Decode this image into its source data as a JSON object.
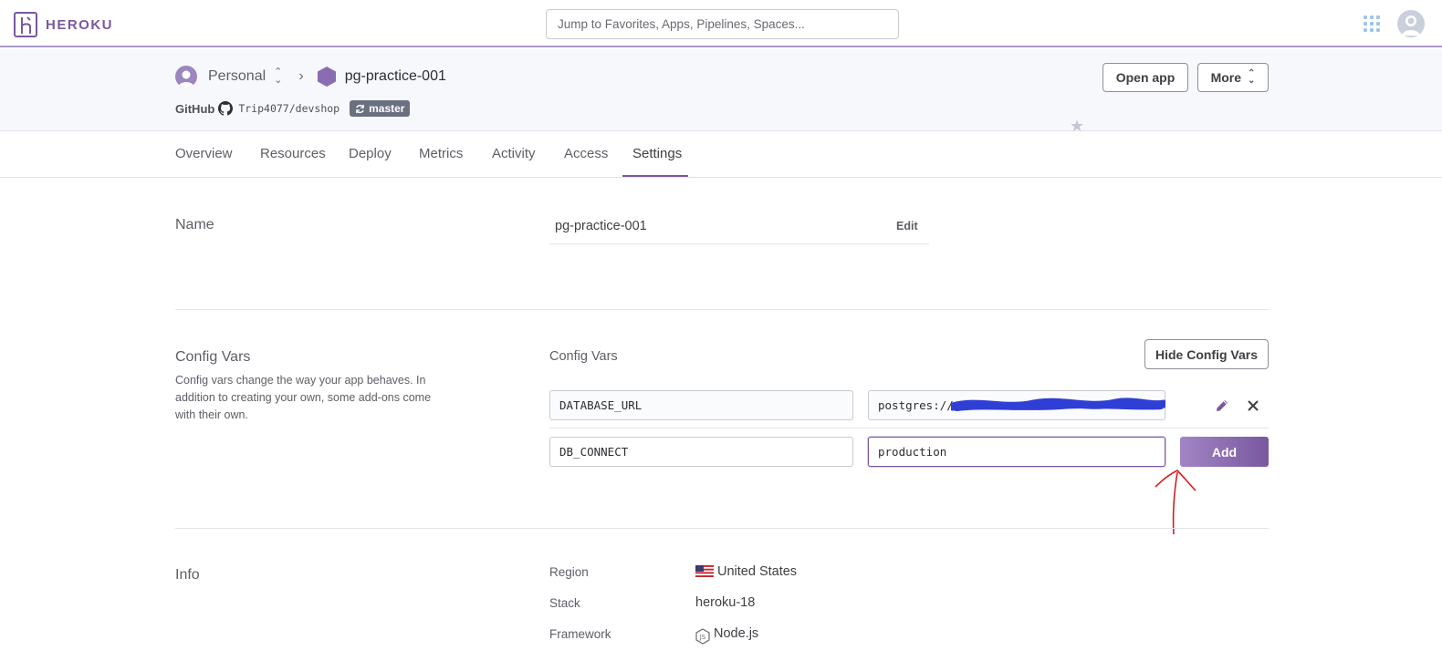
{
  "topbar": {
    "brand": "HEROKU",
    "search_placeholder": "Jump to Favorites, Apps, Pipelines, Spaces..."
  },
  "header": {
    "account": "Personal",
    "app_name": "pg-practice-001",
    "git_provider": "GitHub",
    "repo": "Trip4077/devshop",
    "branch": "master",
    "open_app": "Open app",
    "more": "More"
  },
  "tabs": [
    "Overview",
    "Resources",
    "Deploy",
    "Metrics",
    "Activity",
    "Access",
    "Settings"
  ],
  "active_tab": "Settings",
  "name_section": {
    "title": "Name",
    "value": "pg-practice-001",
    "edit": "Edit"
  },
  "config_vars": {
    "title": "Config Vars",
    "description": "Config vars change the way your app behaves. In addition to creating your own, some add-ons come with their own.",
    "subtitle": "Config Vars",
    "hide_button": "Hide Config Vars",
    "vars": [
      {
        "key": "DATABASE_URL",
        "value": "postgres://xi"
      }
    ],
    "new_key": "DB_CONNECT",
    "new_value": "production",
    "add_button": "Add"
  },
  "info": {
    "title": "Info",
    "rows": [
      {
        "label": "Region",
        "value": "United States"
      },
      {
        "label": "Stack",
        "value": "heroku-18"
      },
      {
        "label": "Framework",
        "value": "Node.js"
      }
    ]
  },
  "colors": {
    "brand": "#79589f",
    "redaction": "#2f3fd6",
    "annotation": "#d42020"
  }
}
